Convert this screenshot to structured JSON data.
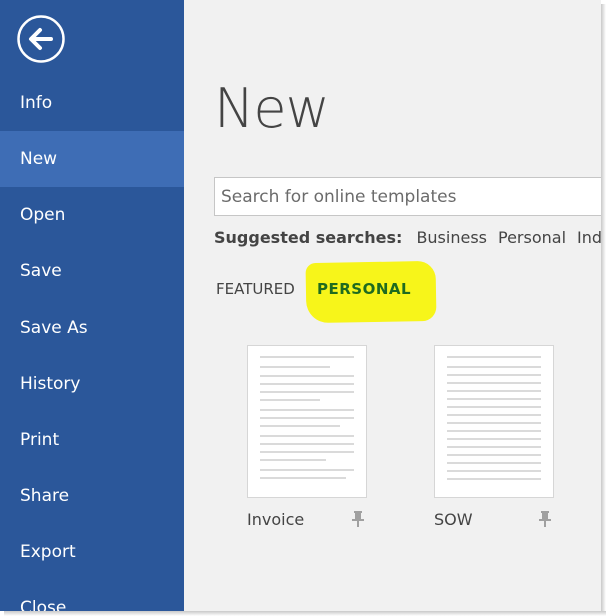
{
  "sidebar": {
    "items": [
      {
        "label": "Info"
      },
      {
        "label": "New",
        "active": true
      },
      {
        "label": "Open"
      },
      {
        "label": "Save"
      },
      {
        "label": "Save As"
      },
      {
        "label": "History"
      },
      {
        "label": "Print"
      },
      {
        "label": "Share"
      },
      {
        "label": "Export"
      },
      {
        "label": "Close"
      }
    ],
    "back_icon": "back-arrow-circle-icon"
  },
  "main": {
    "title": "New",
    "search": {
      "placeholder": "Search for online templates",
      "value": ""
    },
    "suggested": {
      "label": "Suggested searches:",
      "items": [
        "Business",
        "Personal",
        "Indus"
      ]
    },
    "tabs": [
      {
        "label": "FEATURED"
      },
      {
        "label": "PERSONAL",
        "active": true
      }
    ],
    "templates": [
      {
        "name": "Invoice",
        "pin_icon": "pin-icon"
      },
      {
        "name": "SOW",
        "pin_icon": "pin-icon"
      }
    ]
  },
  "colors": {
    "sidebar_bg": "#2b579a",
    "sidebar_active": "#3e6db5",
    "highlight": "#f7f51a",
    "active_tab_text": "#1f6b1f"
  }
}
